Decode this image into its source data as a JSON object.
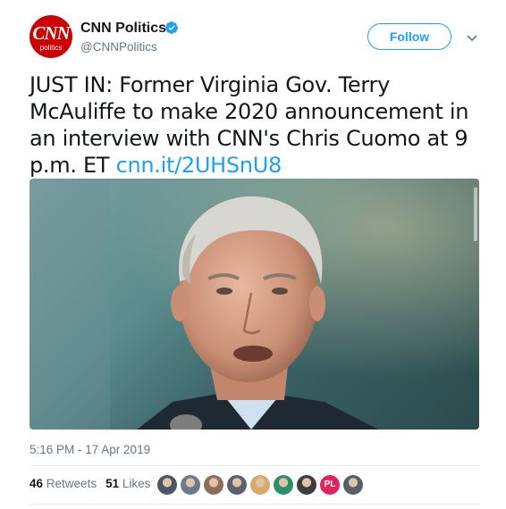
{
  "author": {
    "display_name": "CNN Politics",
    "handle": "@CNNPolitics",
    "avatar_text": "CNN",
    "avatar_subtext": "politics",
    "verified_icon": "verified-badge-icon"
  },
  "actions": {
    "follow_label": "Follow",
    "menu_icon": "chevron-down-icon"
  },
  "tweet": {
    "text": "JUST IN: Former Virginia Gov. Terry McAuliffe to make 2020 announcement in an interview with CNN's Chris Cuomo at 9 p.m. ET",
    "link": "cnn.it/2UHSnU8",
    "timestamp": "5:16 PM - 17 Apr 2019"
  },
  "stats": {
    "retweets_count": "46",
    "retweets_label": "Retweets",
    "likes_count": "51",
    "likes_label": "Likes"
  },
  "likers": [
    {
      "kind": "photo",
      "color": "#4a5568"
    },
    {
      "kind": "photo",
      "color": "#6b7b8c"
    },
    {
      "kind": "photo",
      "color": "#8a6f5a"
    },
    {
      "kind": "photo",
      "color": "#5a6270"
    },
    {
      "kind": "photo",
      "color": "#d9a86c"
    },
    {
      "kind": "photo",
      "color": "#2f8f6b"
    },
    {
      "kind": "photo",
      "color": "#3d3d3d"
    },
    {
      "kind": "initials",
      "text": "PL",
      "color": "#e0245e"
    },
    {
      "kind": "photo",
      "color": "#55606b"
    }
  ],
  "colors": {
    "accent": "#1da1f2",
    "brand": "#cc0000",
    "muted": "#657786"
  }
}
